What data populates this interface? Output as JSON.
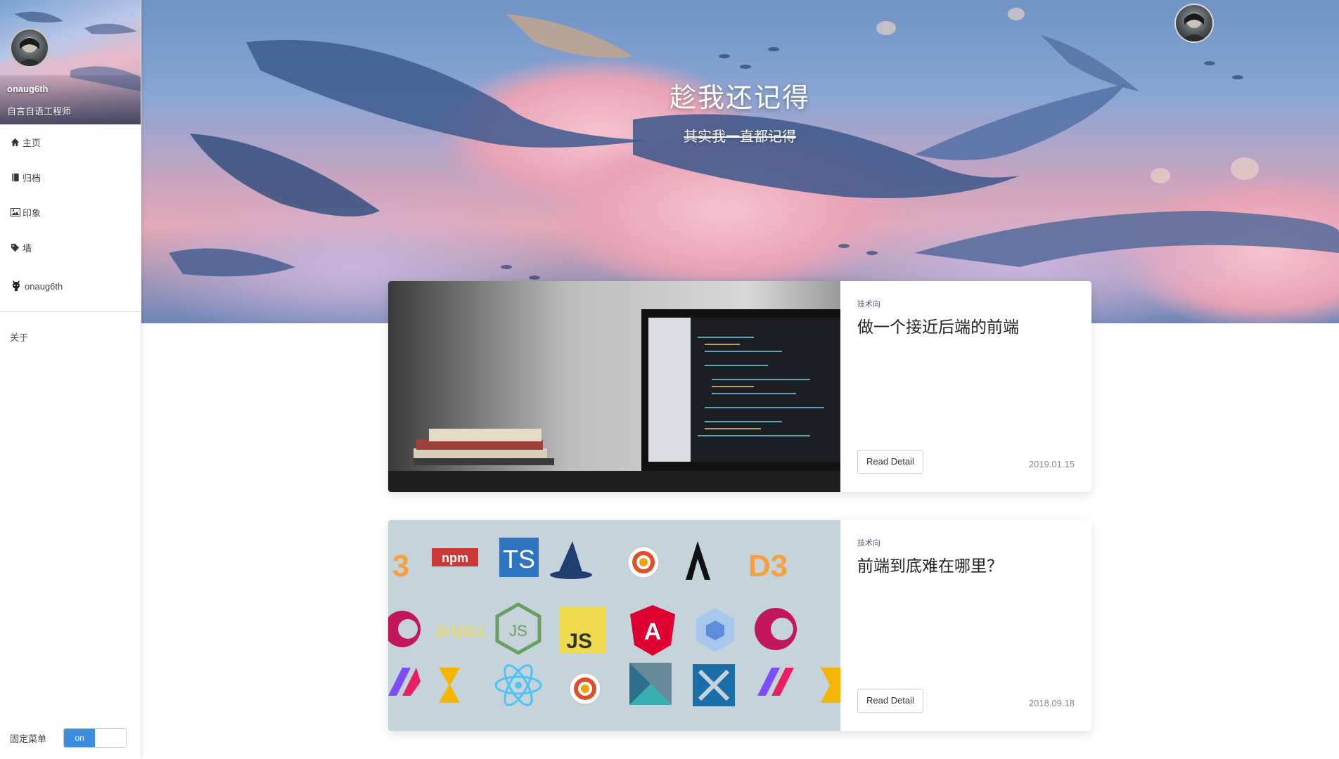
{
  "sidebar": {
    "profile": {
      "name": "onaug6th",
      "title": "自言自语工程师"
    },
    "items": [
      {
        "icon": "home-icon",
        "label": "主页"
      },
      {
        "icon": "book-icon",
        "label": "归档"
      },
      {
        "icon": "image-icon",
        "label": "印象"
      },
      {
        "icon": "tag-icon",
        "label": "墙"
      },
      {
        "icon": "github-icon",
        "label": "onaug6th"
      }
    ],
    "about_label": "关于",
    "pin_menu": {
      "label": "固定菜单",
      "toggle_on": "on",
      "state": "on"
    }
  },
  "hero": {
    "title": "趁我还记得",
    "subtitle": "其实我一直都记得"
  },
  "posts": [
    {
      "category": "技术向",
      "title": "做一个接近后端的前端",
      "button": "Read Detail",
      "date": "2019.01.15",
      "thumb": "laptop-desk-image"
    },
    {
      "category": "技术向",
      "title": "前端到底难在哪里？",
      "button": "Read Detail",
      "date": "2018.09.18",
      "thumb": "frontend-logos-image"
    }
  ],
  "colors": {
    "accent": "#3c8dde",
    "hero_top": "#6f93c4",
    "hero_pink": "#e4a9b8"
  }
}
